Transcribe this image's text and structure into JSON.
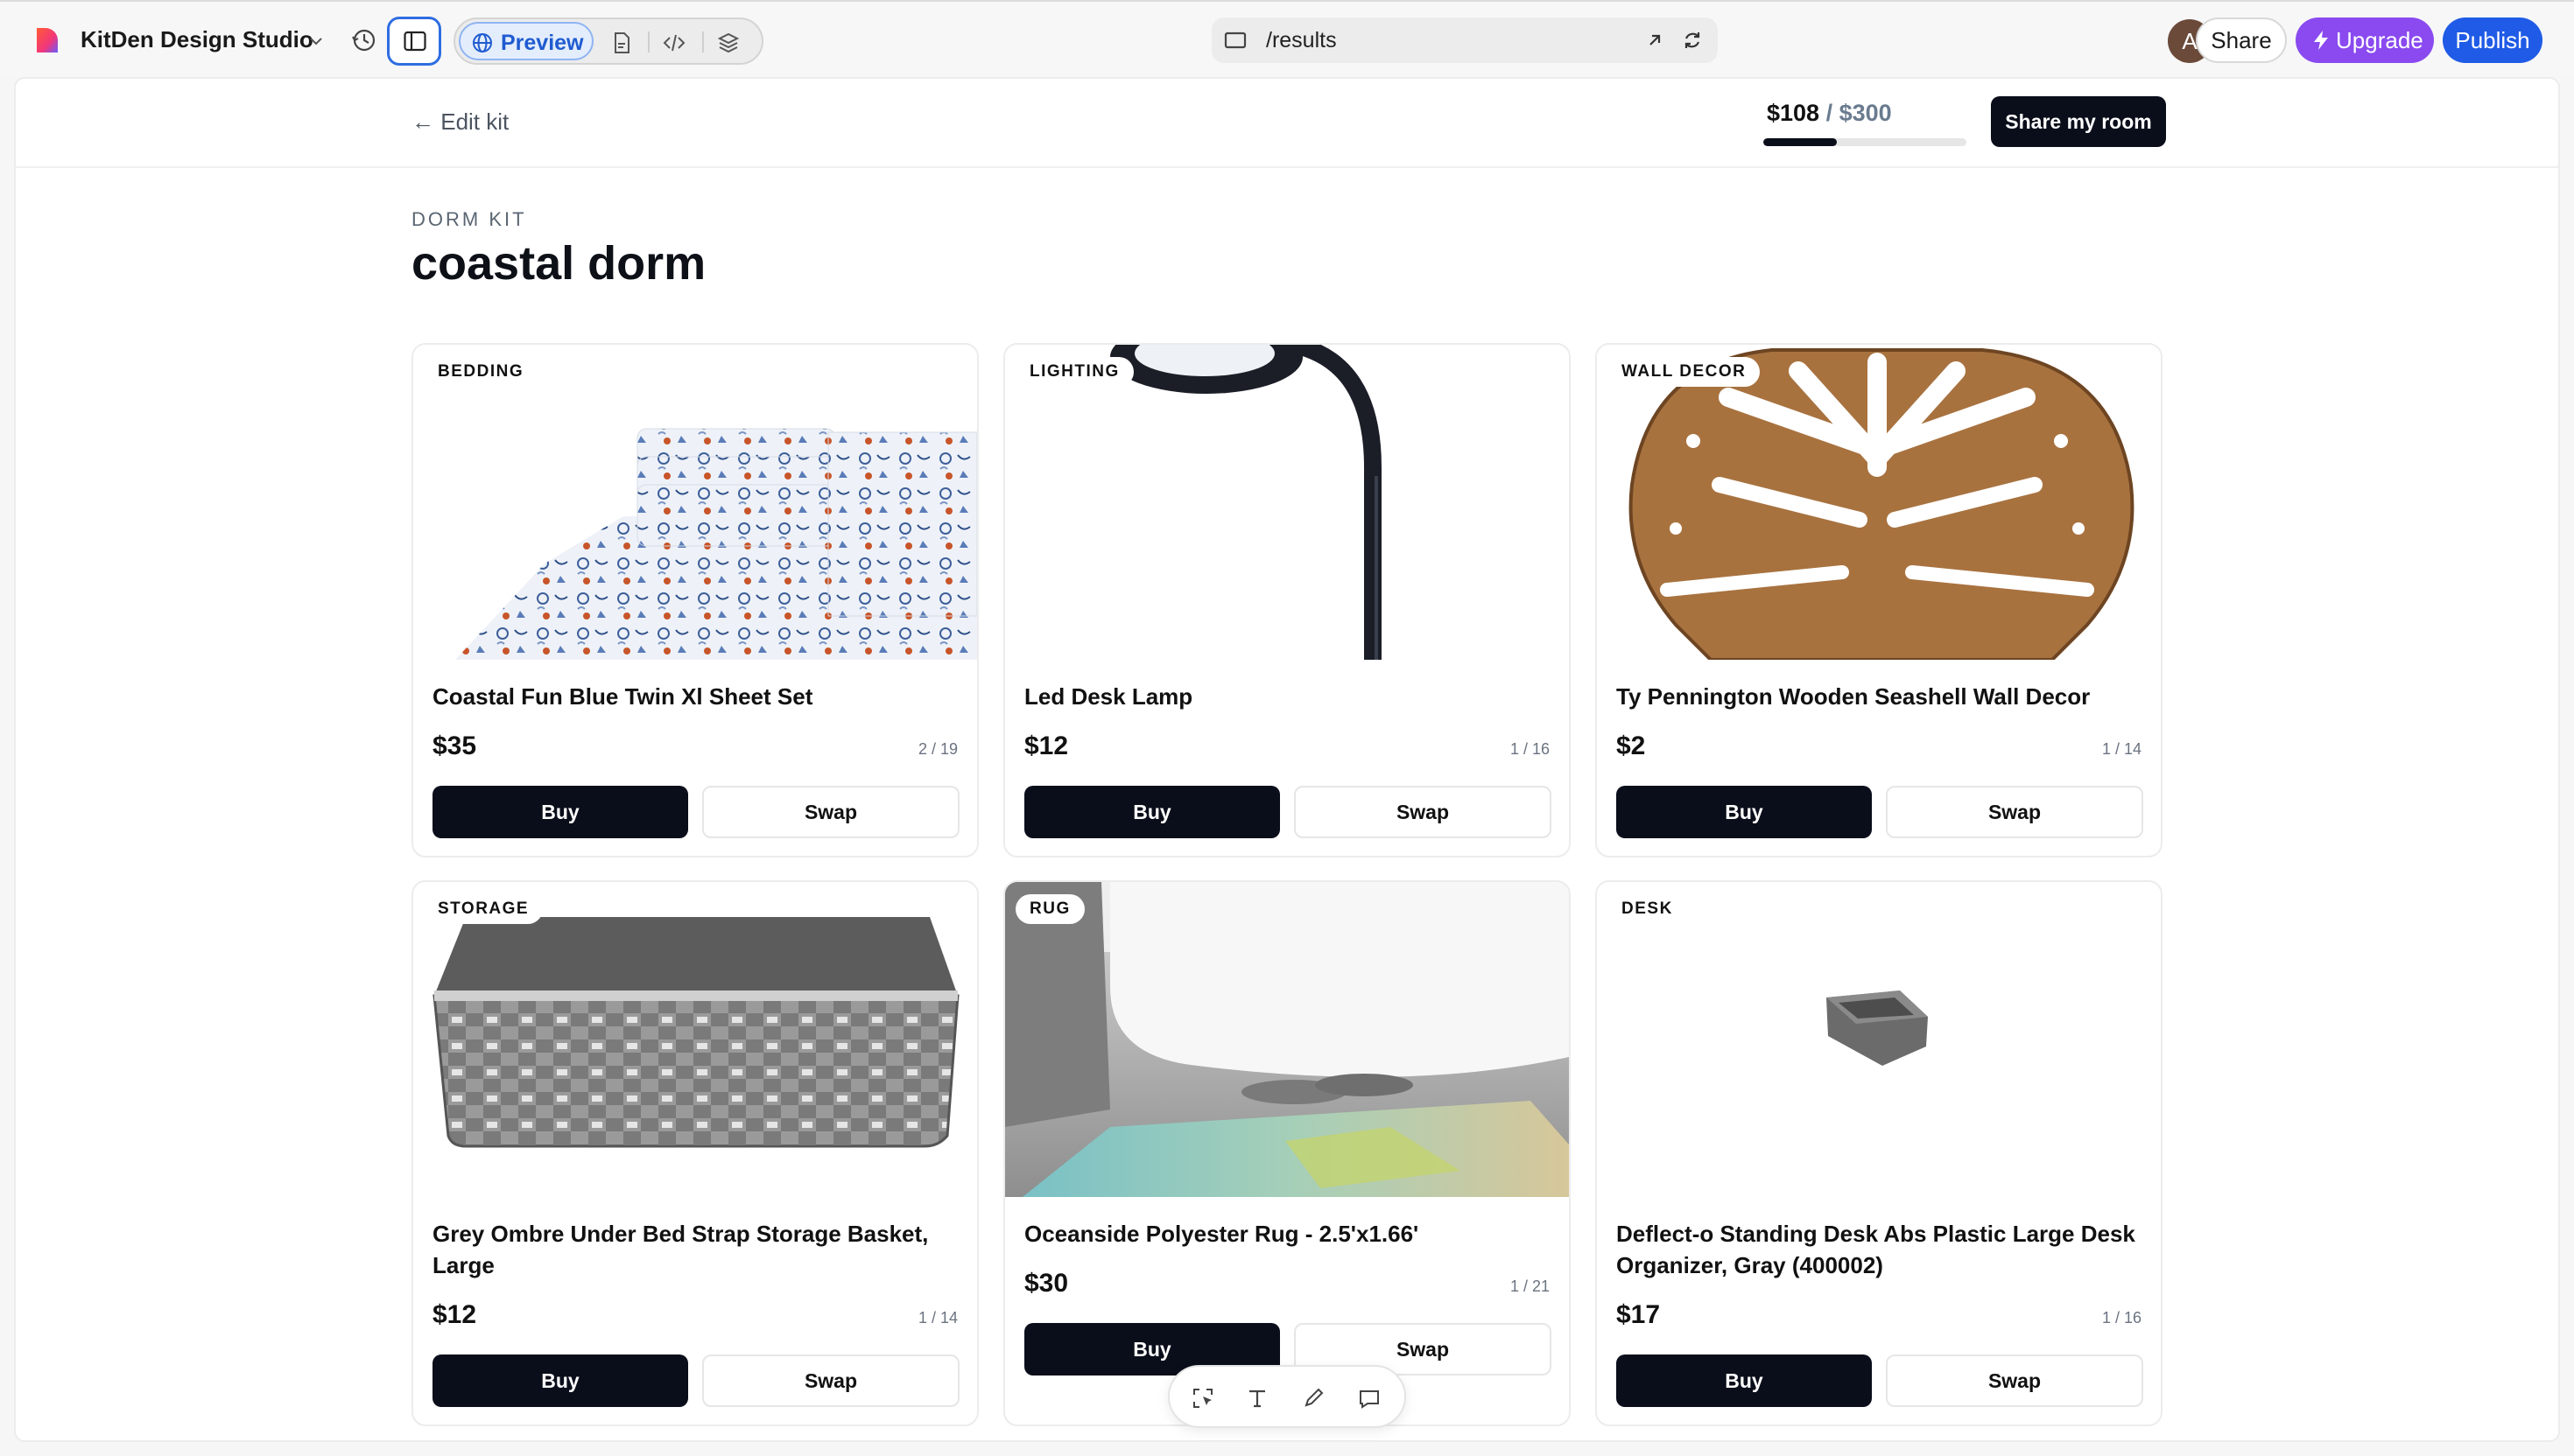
{
  "editor": {
    "project_name": "KitDen Design Studio",
    "preview_label": "Preview",
    "url": "/results",
    "avatar_initial": "A",
    "share_label": "Share",
    "upgrade_label": "Upgrade",
    "publish_label": "Publish"
  },
  "header": {
    "back_label": "← Edit kit",
    "budget_spent": "$108",
    "budget_sep": " / ",
    "budget_total": "$300",
    "budget_fraction": 0.36,
    "share_room_label": "Share my room"
  },
  "kit": {
    "eyebrow": "DORM KIT",
    "title": "coastal dorm"
  },
  "buy_label": "Buy",
  "swap_label": "Swap",
  "items": [
    {
      "category": "BEDDING",
      "name": "Coastal Fun Blue Twin Xl Sheet Set",
      "price": "$35",
      "count": "2 / 19"
    },
    {
      "category": "LIGHTING",
      "name": "Led Desk Lamp",
      "price": "$12",
      "count": "1 / 16"
    },
    {
      "category": "WALL DECOR",
      "name": "Ty Pennington Wooden Seashell Wall Decor",
      "price": "$2",
      "count": "1 / 14"
    },
    {
      "category": "STORAGE",
      "name": "Grey Ombre Under Bed Strap Storage Basket, Large",
      "price": "$12",
      "count": "1 / 14"
    },
    {
      "category": "RUG",
      "name": "Oceanside Polyester Rug - 2.5'x1.66'",
      "price": "$30",
      "count": "1 / 21"
    },
    {
      "category": "DESK",
      "name": "Deflect-o Standing Desk Abs Plastic Large Desk Organizer, Gray (400002)",
      "price": "$17",
      "count": "1 / 16"
    }
  ],
  "colors": {
    "accent_blue": "#1f5be6",
    "upgrade_purple": "#8a4af0",
    "primary_dark": "#0a0e1a"
  }
}
